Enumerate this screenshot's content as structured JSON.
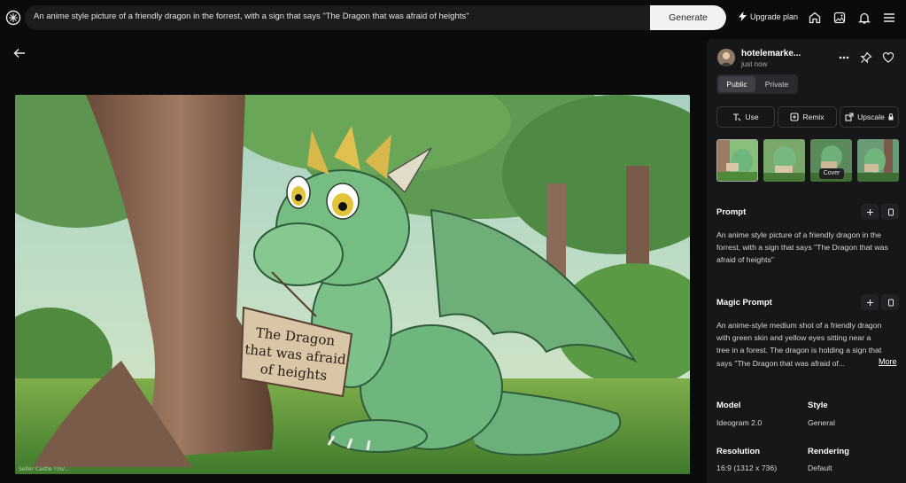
{
  "header": {
    "prompt_text": "An anime style picture of a friendly dragon in the forrest, with a sign that says \"The Dragon that was afraid of heights\"",
    "generate_label": "Generate",
    "upgrade_label": "Upgrade plan"
  },
  "image": {
    "sign_line1": "The Dragon",
    "sign_line2": "that was afraid",
    "sign_line3": "of heights",
    "watermark": "Seller Castle !!/o/..."
  },
  "panel": {
    "username": "hotelemarke...",
    "time": "just now",
    "visibility": {
      "public": "Public",
      "private": "Private"
    },
    "actions": {
      "use": "Use",
      "remix": "Remix",
      "upscale": "Upscale"
    },
    "cover_tooltip": "Cover",
    "prompt_title": "Prompt",
    "prompt_body": "An anime style picture of a friendly dragon in the forrest, with a sign that says \"The Dragon that was afraid of heights\"",
    "magic_title": "Magic Prompt",
    "magic_body": "An anime-style medium shot of a friendly dragon with green skin and yellow eyes sitting near a tree in a forest. The dragon is holding a sign that says \"The Dragon that was afraid of...",
    "more_label": "More",
    "model_label": "Model",
    "model_value": "Ideogram 2.0",
    "style_label": "Style",
    "style_value": "General",
    "resolution_label": "Resolution",
    "resolution_value": "16:9 (1312 x 736)",
    "rendering_label": "Rendering",
    "rendering_value": "Default"
  },
  "colors": {
    "background": "#0b0b0c",
    "panel": "#171719",
    "prompt_bar": "#1c1c1f",
    "generate_button": "#f2f2f3"
  }
}
